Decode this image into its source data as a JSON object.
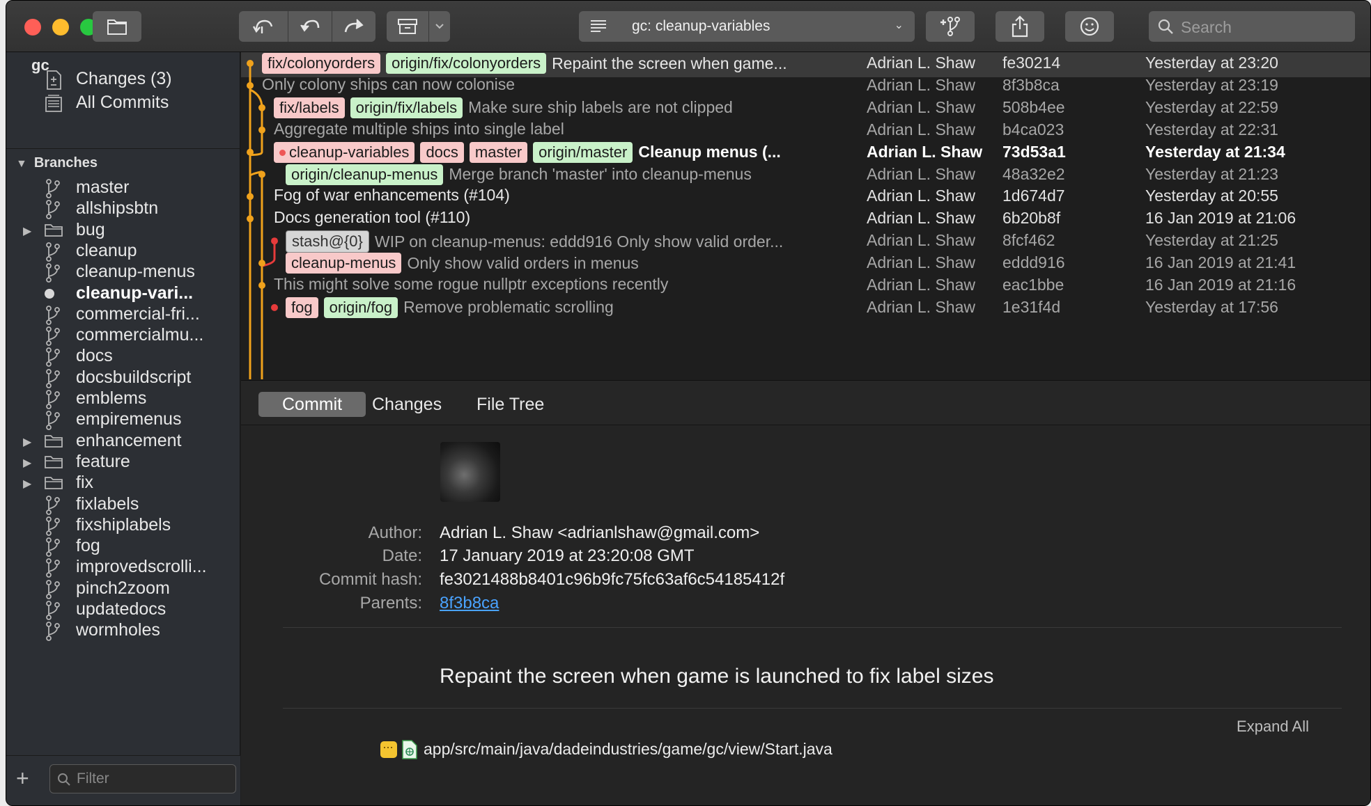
{
  "toolbar": {
    "branch_selector": "gc: cleanup-variables",
    "search_placeholder": "Search"
  },
  "sidebar": {
    "repo_name": "gc",
    "top_items": [
      {
        "label": "Changes (3)",
        "icon": "changes-icon"
      },
      {
        "label": "All Commits",
        "icon": "all-commits-icon"
      }
    ],
    "branches_label": "Branches",
    "branches": [
      {
        "label": "master",
        "type": "branch"
      },
      {
        "label": "allshipsbtn",
        "type": "branch"
      },
      {
        "label": "bug",
        "type": "folder"
      },
      {
        "label": "cleanup",
        "type": "branch"
      },
      {
        "label": "cleanup-menus",
        "type": "branch"
      },
      {
        "label": "cleanup-vari...",
        "type": "current"
      },
      {
        "label": "commercial-fri...",
        "type": "branch"
      },
      {
        "label": "commercialmu...",
        "type": "branch"
      },
      {
        "label": "docs",
        "type": "branch"
      },
      {
        "label": "docsbuildscript",
        "type": "branch"
      },
      {
        "label": "emblems",
        "type": "branch"
      },
      {
        "label": "empiremenus",
        "type": "branch"
      },
      {
        "label": "enhancement",
        "type": "folder"
      },
      {
        "label": "feature",
        "type": "folder"
      },
      {
        "label": "fix",
        "type": "folder"
      },
      {
        "label": "fixlabels",
        "type": "branch"
      },
      {
        "label": "fixshiplabels",
        "type": "branch"
      },
      {
        "label": "fog",
        "type": "branch"
      },
      {
        "label": "improvedscrolli...",
        "type": "branch"
      },
      {
        "label": "pinch2zoom",
        "type": "branch"
      },
      {
        "label": "updatedocs",
        "type": "branch"
      },
      {
        "label": "wormholes",
        "type": "branch"
      }
    ],
    "filter_placeholder": "Filter"
  },
  "commits": [
    {
      "tags": [
        {
          "t": "fix/colonyorders",
          "c": "pink"
        },
        {
          "t": "origin/fix/colonyorders",
          "c": "green"
        }
      ],
      "message": "Repaint the screen when game...",
      "author": "Adrian L. Shaw",
      "hash": "fe30214",
      "date": "Yesterday at 23:20",
      "selected": true
    },
    {
      "tags": [],
      "message": "Only colony ships can now colonise",
      "author": "Adrian L. Shaw",
      "hash": "8f3b8ca",
      "date": "Yesterday at 23:19",
      "dim": true
    },
    {
      "tags": [
        {
          "t": "fix/labels",
          "c": "pink"
        },
        {
          "t": "origin/fix/labels",
          "c": "green"
        }
      ],
      "message": "Make sure ship labels are not clipped",
      "author": "Adrian L. Shaw",
      "hash": "508b4ee",
      "date": "Yesterday at 22:59",
      "dim": true
    },
    {
      "tags": [],
      "message": "Aggregate multiple ships into single label",
      "author": "Adrian L. Shaw",
      "hash": "b4ca023",
      "date": "Yesterday at 22:31",
      "dim": true
    },
    {
      "tags": [
        {
          "t": "cleanup-variables",
          "c": "pink",
          "dot": true
        },
        {
          "t": "docs",
          "c": "pink"
        },
        {
          "t": "master",
          "c": "pink"
        },
        {
          "t": "origin/master",
          "c": "green"
        }
      ],
      "message": "Cleanup menus (...",
      "author": "Adrian L. Shaw",
      "hash": "73d53a1",
      "date": "Yesterday at 21:34",
      "bold": true
    },
    {
      "tags": [
        {
          "t": "origin/cleanup-menus",
          "c": "green"
        }
      ],
      "message": "Merge branch 'master' into cleanup-menus",
      "author": "Adrian L. Shaw",
      "hash": "48a32e2",
      "date": "Yesterday at 21:23",
      "dim": true
    },
    {
      "tags": [],
      "message": "Fog of war enhancements (#104)",
      "author": "Adrian L. Shaw",
      "hash": "1d674d7",
      "date": "Yesterday at 20:55"
    },
    {
      "tags": [],
      "message": "Docs generation tool  (#110)",
      "author": "Adrian L. Shaw",
      "hash": "6b20b8f",
      "date": "16 Jan 2019 at 21:06"
    },
    {
      "tags": [
        {
          "t": "stash@{0}",
          "c": "stash"
        }
      ],
      "message": "WIP on cleanup-menus: eddd916 Only show valid order...",
      "author": "Adrian L. Shaw",
      "hash": "8fcf462",
      "date": "Yesterday at 21:25",
      "dim": true
    },
    {
      "tags": [
        {
          "t": "cleanup-menus",
          "c": "pink"
        }
      ],
      "message": "Only show valid orders in menus",
      "author": "Adrian L. Shaw",
      "hash": "eddd916",
      "date": "16 Jan 2019 at 21:41",
      "dim": true
    },
    {
      "tags": [],
      "message": "This might solve some rogue nullptr exceptions recently",
      "author": "Adrian L. Shaw",
      "hash": "eac1bbe",
      "date": "16 Jan 2019 at 21:16",
      "dim": true
    },
    {
      "tags": [
        {
          "t": "fog",
          "c": "pink"
        },
        {
          "t": "origin/fog",
          "c": "green"
        }
      ],
      "message": "Remove problematic scrolling",
      "author": "Adrian L. Shaw",
      "hash": "1e31f4d",
      "date": "Yesterday at 17:56",
      "dim": true
    }
  ],
  "detail": {
    "tabs": [
      "Commit",
      "Changes",
      "File Tree"
    ],
    "author_label": "Author:",
    "author_value": "Adrian L. Shaw <adrianlshaw@gmail.com>",
    "date_label": "Date:",
    "date_value": "17 January 2019 at 23:20:08 GMT",
    "hash_label": "Commit hash:",
    "hash_value": "fe3021488b8401c96b9fc75fc63af6c54185412f",
    "parents_label": "Parents:",
    "parents_value": "8f3b8ca",
    "summary": "Repaint the screen when game is launched to fix label sizes",
    "expand_all": "Expand All",
    "file_path": "app/src/main/java/dadeindustries/game/gc/view/Start.java",
    "file_status_glyph": "···"
  },
  "colors": {
    "graph_main": "#f0a21c",
    "graph_branch": "#e63b3b",
    "tag_local": "#f8c9c9",
    "tag_remote": "#c9f1c9",
    "link": "#4aa3ff"
  }
}
